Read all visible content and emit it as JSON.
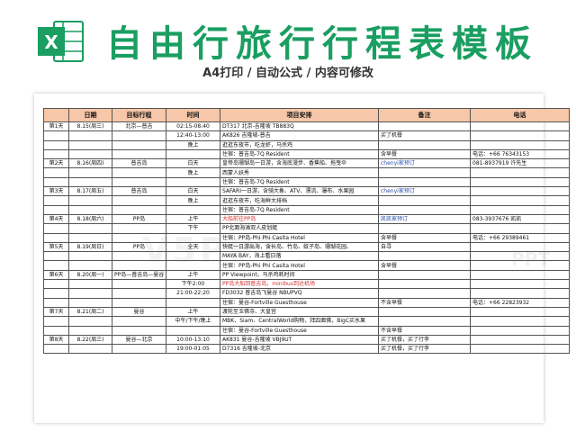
{
  "header": {
    "title": "自由行旅行行程表模板",
    "subtitle": "A4打印 / 自动公式 / 内容可修改",
    "logo_icon": "excel-icon",
    "brand_color": "#1a9e61"
  },
  "table": {
    "columns": [
      "",
      "日期",
      "目标行程",
      "时间",
      "项目安排",
      "备注",
      "电话"
    ],
    "rows": [
      [
        "第1天",
        "8.15(周三)",
        "北京—普吉",
        "02:15-08:40",
        "DT317 北京-吉隆坡    TB883Q",
        "",
        ""
      ],
      [
        "",
        "",
        "",
        "12:40-13:00",
        "AK826 吉隆坡-普吉",
        "买了机餐",
        ""
      ],
      [
        "",
        "",
        "",
        "晚上",
        "逛逛东夜市，吃龙虾，马杀鸡",
        "",
        ""
      ],
      [
        "",
        "",
        "",
        "",
        "住宿：普吉岛-7Q Resident",
        "含早餐",
        "电话：+66 76343153"
      ],
      [
        "第2天",
        "8.16(周四)",
        "普吉岛",
        "白天",
        "皇帝岛珊瑚岛一日游，含海底漫步、香蕉船、拖曳伞",
        "chenyi家预订",
        "081-8937919 许先生"
      ],
      [
        "",
        "",
        "",
        "晚上",
        "西蒙人妖秀",
        "",
        ""
      ],
      [
        "",
        "",
        "",
        "",
        "住宿：普吉岛-7Q Resident",
        "",
        ""
      ],
      [
        "第3天",
        "8.17(周五)",
        "普吉岛",
        "白天",
        "SAFARI一日游，含骑大象、ATV、漂流、瀑布、水果园",
        "chenyi家预订",
        ""
      ],
      [
        "",
        "",
        "",
        "晚上",
        "逛逛东夜市，吃海鲜大排档",
        "",
        ""
      ],
      [
        "",
        "",
        "",
        "",
        "住宿：普吉岛-7Q Resident",
        "",
        ""
      ],
      [
        "第4天",
        "8.18(周六)",
        "PP岛",
        "上午",
        "大船前往PP岛",
        "凯凯家预订",
        "083-3937676 凯凯"
      ],
      [
        "",
        "",
        "",
        "下午",
        "PP北面海滩双人皮划艇",
        "",
        ""
      ],
      [
        "",
        "",
        "",
        "",
        "住宿：PP岛-Phi Phi Casita Hotel",
        "含早餐",
        "电话：+66 29389461"
      ],
      [
        "第5天",
        "8.19(周日)",
        "PP岛",
        "全天",
        "快艇一日游出海，含长岛、竹岛、蚊子岛、珊瑚花园、",
        "自寻",
        ""
      ],
      [
        "",
        "",
        "",
        "",
        "MAYA BAY，海上看日落",
        "",
        ""
      ],
      [
        "",
        "",
        "",
        "",
        "住宿：PP岛-Phi Phi Casita Hotel",
        "含早餐",
        ""
      ],
      [
        "第6天",
        "8.20(周一)",
        "PP岛—普吉岛—曼谷",
        "上午",
        "PP Viewpoint，马杀鸡耗时间",
        "",
        ""
      ],
      [
        "",
        "",
        "",
        "下午2:00",
        "PP岛大船回普吉岛，minibus到达机场",
        "",
        ""
      ],
      [
        "",
        "",
        "",
        "21:00-22:20",
        "FD3032 普吉岛飞曼谷   NBUPVQ",
        "",
        ""
      ],
      [
        "",
        "",
        "",
        "",
        "住宿：曼谷-Fortville Guesthouse",
        "不含早餐",
        "电话：+66 22823932"
      ],
      [
        "第7天",
        "8.21(周二)",
        "曼谷",
        "上午",
        "渡轮至玉佛寺、大皇宫",
        "",
        ""
      ],
      [
        "",
        "",
        "",
        "中午/下午/晚上",
        "MBK、Siam、CentralWorld购物，拜四面佛，BigC买水果",
        "",
        ""
      ],
      [
        "",
        "",
        "",
        "",
        "住宿：曼谷-Fortville Guesthouse",
        "不含早餐",
        ""
      ],
      [
        "第8天",
        "8.22(周三)",
        "曼谷—北京",
        "10:00-13:10",
        "AK831 曼谷-吉隆坡    VBJ9UT",
        "买了机餐，买了行李",
        ""
      ],
      [
        "",
        "",
        "",
        "19:00-01:05",
        "D7316 吉隆坡-北京",
        "买了机餐，买了行李",
        ""
      ]
    ],
    "highlight": {
      "red_cells": [
        [
          10,
          4
        ],
        [
          17,
          4
        ]
      ],
      "blue_cells": [
        [
          4,
          5
        ],
        [
          7,
          5
        ],
        [
          10,
          5
        ]
      ]
    },
    "header_color": "#f6c7a8"
  }
}
